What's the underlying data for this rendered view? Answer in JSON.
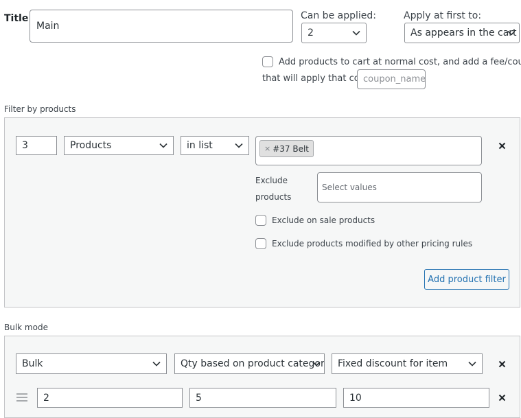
{
  "title_section": {
    "label": "Title",
    "value": "Main"
  },
  "can_be_applied": {
    "label": "Can be applied:",
    "value": "2"
  },
  "apply_first": {
    "label": "Apply at first to:",
    "value": "As appears in the cart"
  },
  "normal_cost": {
    "line1": "Add products to cart at normal cost, and add a fee/coupon",
    "line2": "that will apply that cost",
    "coupon_placeholder": "coupon_name"
  },
  "filter_products": {
    "heading": "Filter by products",
    "qty": "3",
    "type": "Products",
    "method": "in list",
    "tag": "#37 Belt",
    "tag_remove": "×",
    "exclude_label_1": "Exclude",
    "exclude_label_2": "products",
    "exclude_placeholder": "Select values",
    "exclude_on_sale": "Exclude on sale products",
    "exclude_modified": "Exclude products modified by other pricing rules",
    "add_button": "Add product filter"
  },
  "bulk_mode": {
    "heading": "Bulk mode",
    "mode": "Bulk",
    "qty_based": "Qty based on product categor",
    "discount_type": "Fixed discount for item",
    "row": {
      "from": "2",
      "to": "5",
      "value": "10"
    }
  },
  "icons": {
    "remove": "close-icon",
    "drag": "drag-handle-icon",
    "dropdown": "chevron-down-icon"
  },
  "colors": {
    "accent": "#2271b1",
    "border": "#8c8f94",
    "panel_bg": "#f6f7f7",
    "text": "#3c434a"
  }
}
